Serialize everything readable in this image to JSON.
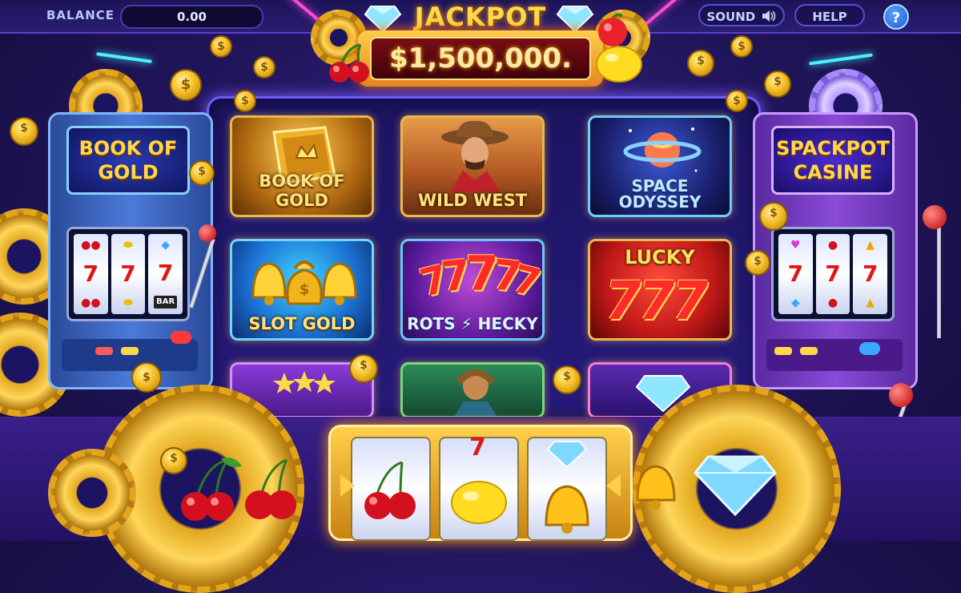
{
  "balance": {
    "label": "BALANCE",
    "value": "0.00"
  },
  "controls": {
    "sound_label": "SOUND",
    "sound_icon": "speaker-icon",
    "help_label": "HELP",
    "info_label": "?"
  },
  "jackpot": {
    "title": "JACKPOT",
    "amount": "$1,500,000."
  },
  "games": [
    {
      "label": "BOOK OF GOLD",
      "icon": "book-icon"
    },
    {
      "label": "WILD WEST",
      "icon": "cowboy-icon"
    },
    {
      "label": "SPACE ODYSSEY",
      "icon": "planet-icon"
    },
    {
      "label": "SLOT GOLD",
      "icon": "bell-icon"
    },
    {
      "label": "ROTS ⚡ HECKY",
      "icon": "sevens-icon"
    },
    {
      "label": "LUCKY",
      "icon": "sevens-icon",
      "sub": "777"
    }
  ],
  "left_machine": {
    "title": "BOOK OF GOLD",
    "reel_symbols": [
      "7",
      "7",
      "7"
    ],
    "bar_label": "BAR"
  },
  "right_machine": {
    "title": "SPACKPOT CASINE",
    "reel_symbols": [
      "7",
      "7",
      "7"
    ]
  },
  "bottom_reels": {
    "symbols": [
      "cherry",
      "lemon",
      "bell"
    ]
  },
  "colors": {
    "accent": "#ffd84a",
    "frame": "#6d5bff",
    "jackpot_bg": "#7a0c14"
  }
}
